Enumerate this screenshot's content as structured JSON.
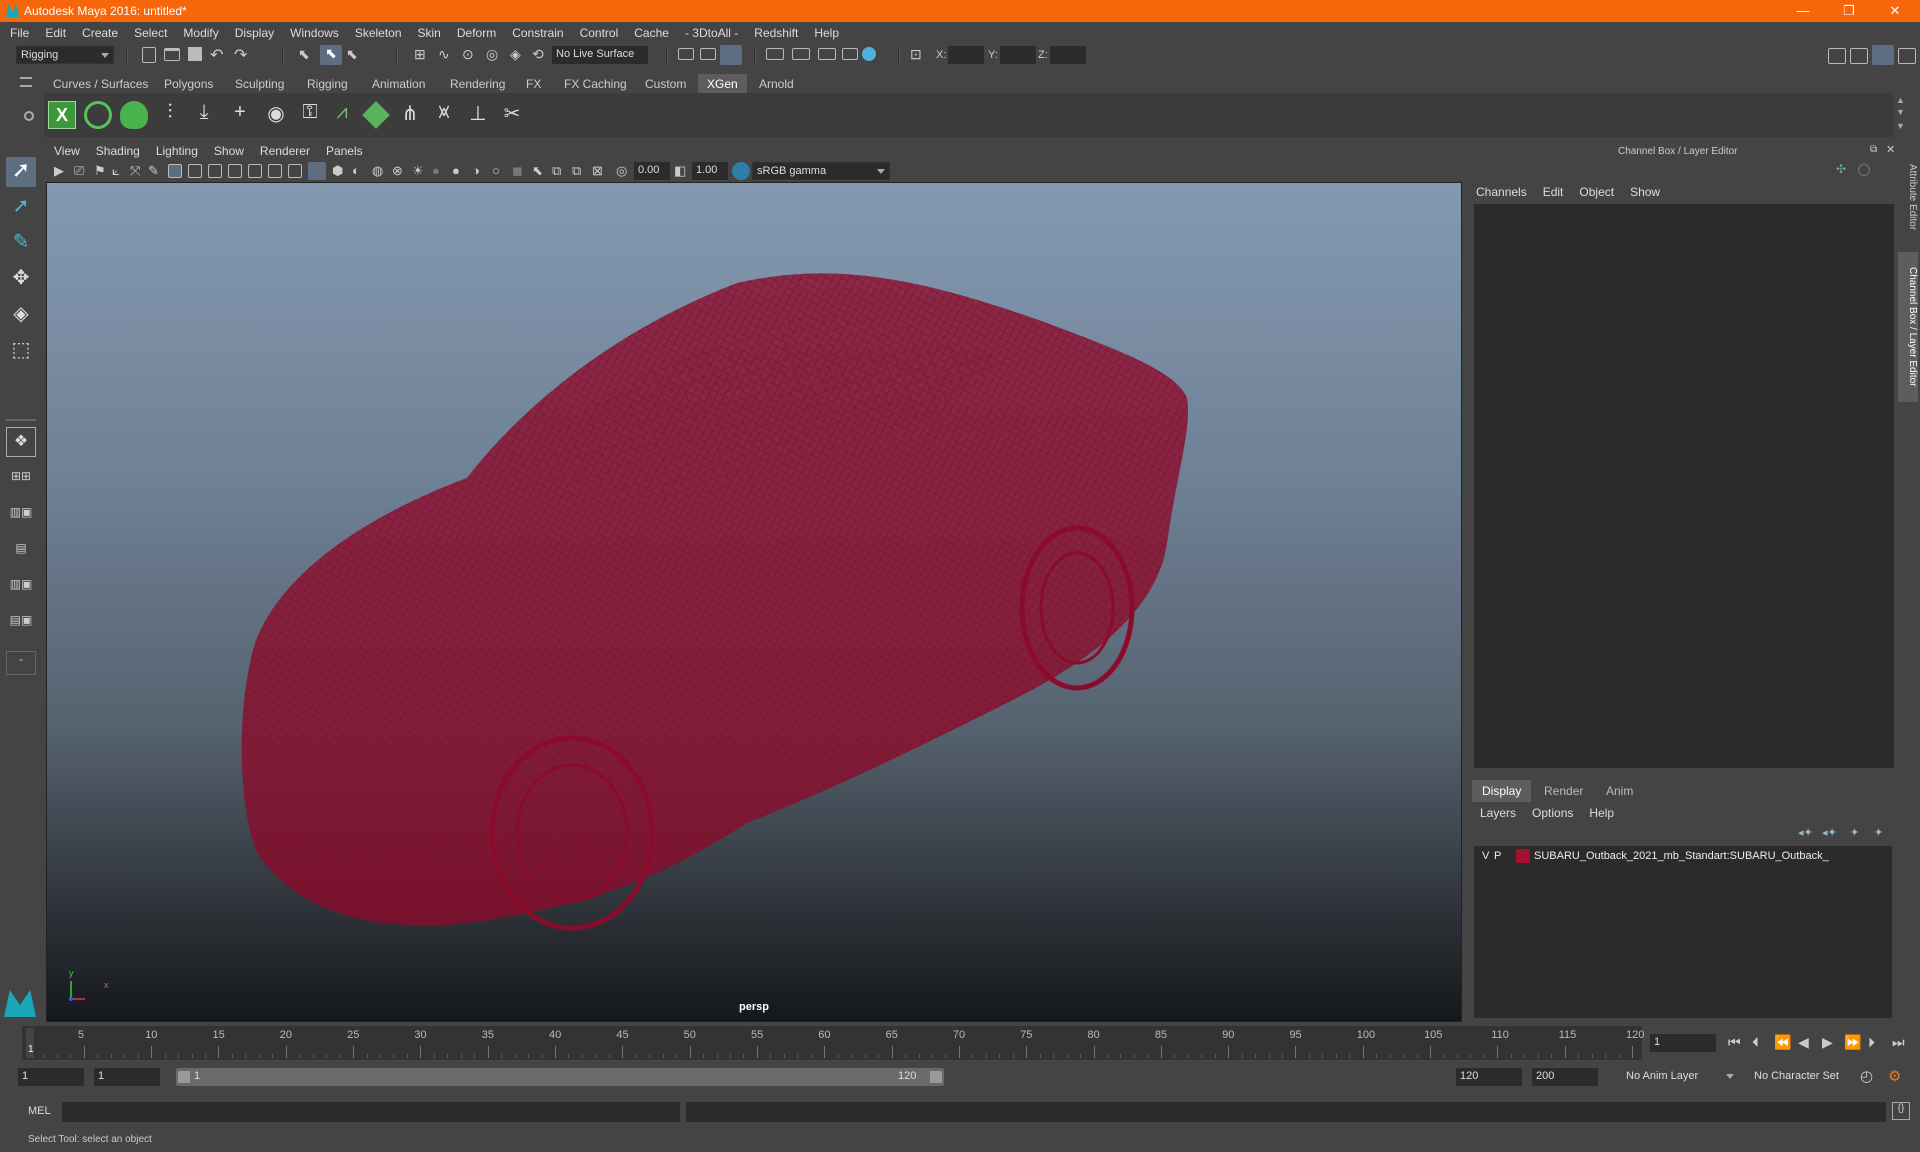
{
  "window": {
    "title": "Autodesk Maya 2016: untitled*",
    "controls": [
      "—",
      "❐",
      "✕"
    ]
  },
  "menubar": [
    "File",
    "Edit",
    "Create",
    "Select",
    "Modify",
    "Display",
    "Windows",
    "Skeleton",
    "Skin",
    "Deform",
    "Constrain",
    "Control",
    "Cache",
    "- 3DtoAll -",
    "Redshift",
    "Help"
  ],
  "statusline": {
    "menuset": "Rigging",
    "live_surface": "No Live Surface",
    "x_label": "X:",
    "y_label": "Y:",
    "z_label": "Z:"
  },
  "shelf_tabs": [
    "Curves / Surfaces",
    "Polygons",
    "Sculpting",
    "Rigging",
    "Animation",
    "Rendering",
    "FX",
    "FX Caching",
    "Custom",
    "XGen",
    "Arnold"
  ],
  "shelf_active": "XGen",
  "viewport": {
    "menus": [
      "View",
      "Shading",
      "Lighting",
      "Show",
      "Renderer",
      "Panels"
    ],
    "exposure": "0.00",
    "gamma": "1.00",
    "color_space": "sRGB gamma",
    "camera": "persp",
    "axis_x": "x",
    "axis_y": "y",
    "wire_color": "#8a0b2b"
  },
  "channel_box": {
    "title": "Channel Box / Layer Editor",
    "menus": [
      "Channels",
      "Edit",
      "Object",
      "Show"
    ]
  },
  "layer_editor": {
    "tabs": [
      "Display",
      "Render",
      "Anim"
    ],
    "active_tab": "Display",
    "menus": [
      "Layers",
      "Options",
      "Help"
    ],
    "layer": {
      "v": "V",
      "p": "P",
      "color": "#a3102f",
      "name": "SUBARU_Outback_2021_mb_Standart:SUBARU_Outback_"
    }
  },
  "side_tabs": [
    "Attribute Editor",
    "Channel Box / Layer Editor"
  ],
  "timeslider": {
    "ticks": [
      5,
      10,
      15,
      20,
      25,
      30,
      35,
      40,
      45,
      50,
      55,
      60,
      65,
      70,
      75,
      80,
      85,
      90,
      95,
      100,
      105,
      110,
      115,
      120
    ],
    "current_frame_marker": "1",
    "current_frame_field": "1"
  },
  "range": {
    "start_time": "1",
    "playback_start": "1",
    "slider_start": "1",
    "slider_end": "120",
    "playback_end": "120",
    "end_time": "200",
    "anim_layer": "No Anim Layer",
    "character_set": "No Character Set"
  },
  "mel": {
    "label": "MEL"
  },
  "helpline": "Select Tool: select an object"
}
